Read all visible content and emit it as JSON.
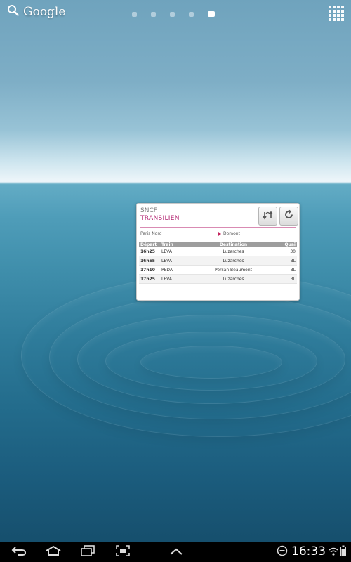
{
  "home": {
    "google_label": "Google",
    "pages": [
      false,
      false,
      false,
      false,
      true
    ]
  },
  "widget": {
    "brand": "SNCF",
    "product": "TRANSILIEN",
    "origin": "Paris Nord",
    "destination": "Domont",
    "columns": [
      "Départ",
      "Train",
      "Destination",
      "Quai"
    ],
    "rows": [
      {
        "depart": "16h25",
        "train": "LEVA",
        "destination": "Luzarches",
        "quai": "30"
      },
      {
        "depart": "16h55",
        "train": "LEVA",
        "destination": "Luzarches",
        "quai": "BL"
      },
      {
        "depart": "17h10",
        "train": "PEDA",
        "destination": "Persan Beaumont",
        "quai": "BL"
      },
      {
        "depart": "17h25",
        "train": "LEVA",
        "destination": "Luzarches",
        "quai": "BL"
      }
    ],
    "accent_color": "#b2226f"
  },
  "statusbar": {
    "time": "16:33"
  },
  "icons": [
    "search-icon",
    "apps-grid-icon",
    "swap-direction-icon",
    "refresh-icon",
    "back-icon",
    "home-icon",
    "recent-apps-icon",
    "screenshot-icon",
    "up-arrow-icon",
    "minus-circle-icon",
    "wifi-icon",
    "battery-icon"
  ]
}
